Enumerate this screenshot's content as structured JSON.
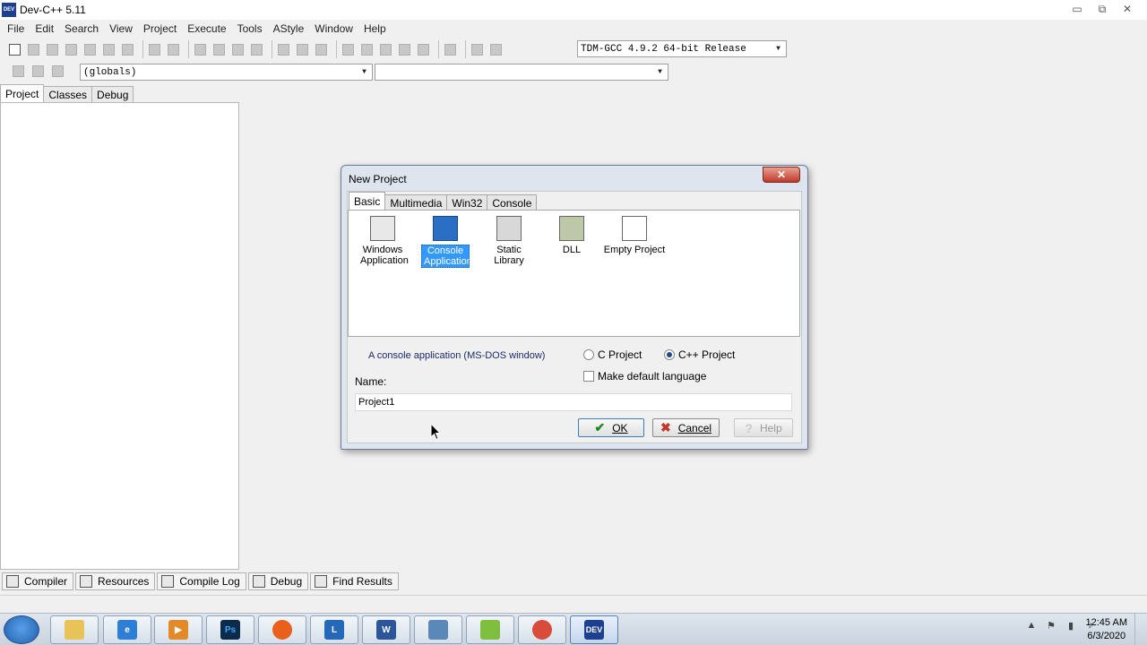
{
  "window": {
    "title": "Dev-C++ 5.11",
    "icon_text": "DEV",
    "controls": [
      "▭",
      "⧉",
      "✕"
    ]
  },
  "menu": [
    "File",
    "Edit",
    "Search",
    "View",
    "Project",
    "Execute",
    "Tools",
    "AStyle",
    "Window",
    "Help"
  ],
  "toolbar": {
    "compiler_select": "TDM-GCC 4.9.2 64-bit Release",
    "scope_select": "(globals)",
    "function_select": ""
  },
  "left_tabs": [
    "Project",
    "Classes",
    "Debug"
  ],
  "bottom_tabs": [
    "Compiler",
    "Resources",
    "Compile Log",
    "Debug",
    "Find Results"
  ],
  "dialog": {
    "title": "New Project",
    "close_label": "✕",
    "tabs": [
      "Basic",
      "Multimedia",
      "Win32",
      "Console"
    ],
    "templates": [
      {
        "label": "Windows Application"
      },
      {
        "label": "Console Application"
      },
      {
        "label": "Static Library"
      },
      {
        "label": "DLL"
      },
      {
        "label": "Empty Project"
      }
    ],
    "description": "A console application (MS-DOS window)",
    "radio_c": "C Project",
    "radio_cpp": "C++ Project",
    "selected_language": "C++ Project",
    "default_language_label": "Make default language",
    "name_label": "Name:",
    "name_value": "Project1",
    "ok_label": "OK",
    "cancel_label": "Cancel",
    "help_label": "Help"
  },
  "taskbar": {
    "apps": [
      {
        "name": "explorer",
        "text": "",
        "color": "#e8c35a"
      },
      {
        "name": "internet-explorer",
        "text": "e",
        "color": "#2d7fd6"
      },
      {
        "name": "media-player",
        "text": "▶",
        "color": "#e28a2a"
      },
      {
        "name": "photoshop",
        "text": "Ps",
        "color": "#0c2a4a"
      },
      {
        "name": "firefox",
        "text": "",
        "color": "#e8601c"
      },
      {
        "name": "lync",
        "text": "L",
        "color": "#2469b8"
      },
      {
        "name": "word",
        "text": "W",
        "color": "#2b579a"
      },
      {
        "name": "remote-desktop",
        "text": "",
        "color": "#5a88b8"
      },
      {
        "name": "notepad-plus",
        "text": "",
        "color": "#7fbf3f"
      },
      {
        "name": "chrome",
        "text": "",
        "color": "#d94b3a"
      },
      {
        "name": "devcpp",
        "text": "DEV",
        "color": "#1c3f8f"
      }
    ],
    "clock_time": "12:45 AM",
    "clock_date": "6/3/2020"
  }
}
